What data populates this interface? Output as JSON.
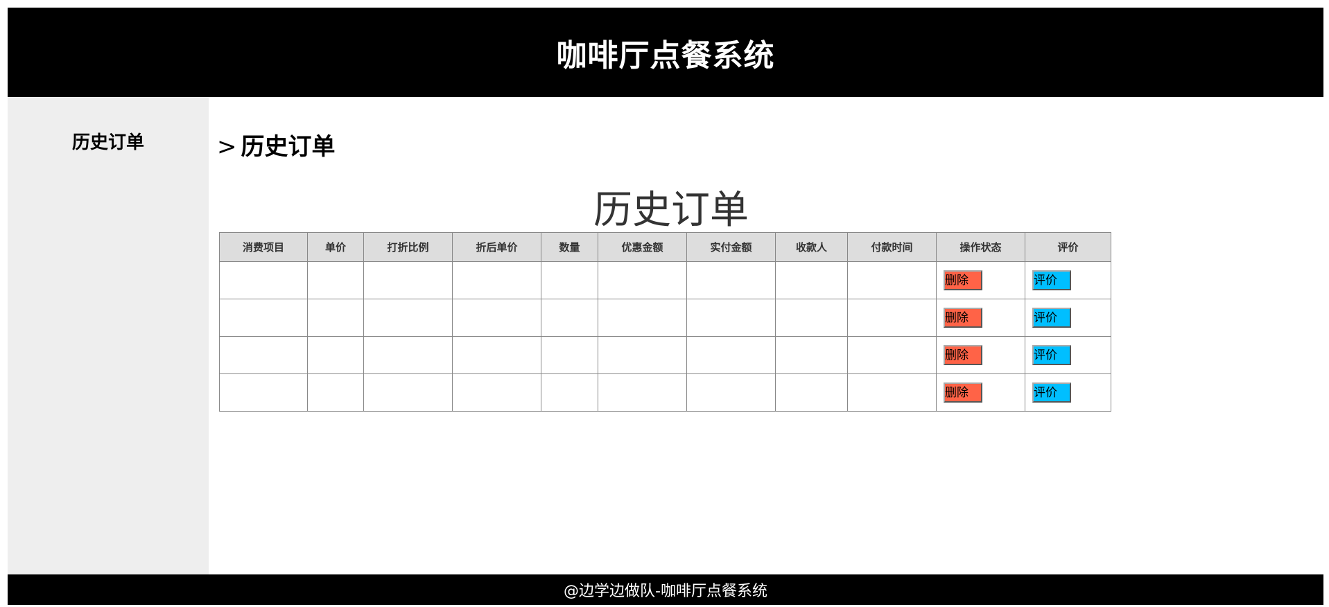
{
  "header": {
    "title": "咖啡厅点餐系统"
  },
  "sidebar": {
    "items": [
      {
        "label": "历史订单"
      }
    ]
  },
  "breadcrumb": {
    "separator": ">",
    "current": "历史订单"
  },
  "main": {
    "heading": "历史订单"
  },
  "table": {
    "columns": [
      "消费项目",
      "单价",
      "打折比例",
      "折后单价",
      "数量",
      "优惠金额",
      "实付金额",
      "收款人",
      "付款时间",
      "操作状态",
      "评价"
    ],
    "rows": [
      {
        "delete_label": "删除",
        "review_label": "评价"
      },
      {
        "delete_label": "删除",
        "review_label": "评价"
      },
      {
        "delete_label": "删除",
        "review_label": "评价"
      },
      {
        "delete_label": "删除",
        "review_label": "评价"
      }
    ]
  },
  "footer": {
    "text": "@边学边做队-咖啡厅点餐系统"
  },
  "colors": {
    "header_bg": "#000000",
    "sidebar_bg": "#eeeeee",
    "table_header_bg": "#dddddd",
    "delete_button": "#ff6347",
    "review_button": "#00bfff"
  }
}
